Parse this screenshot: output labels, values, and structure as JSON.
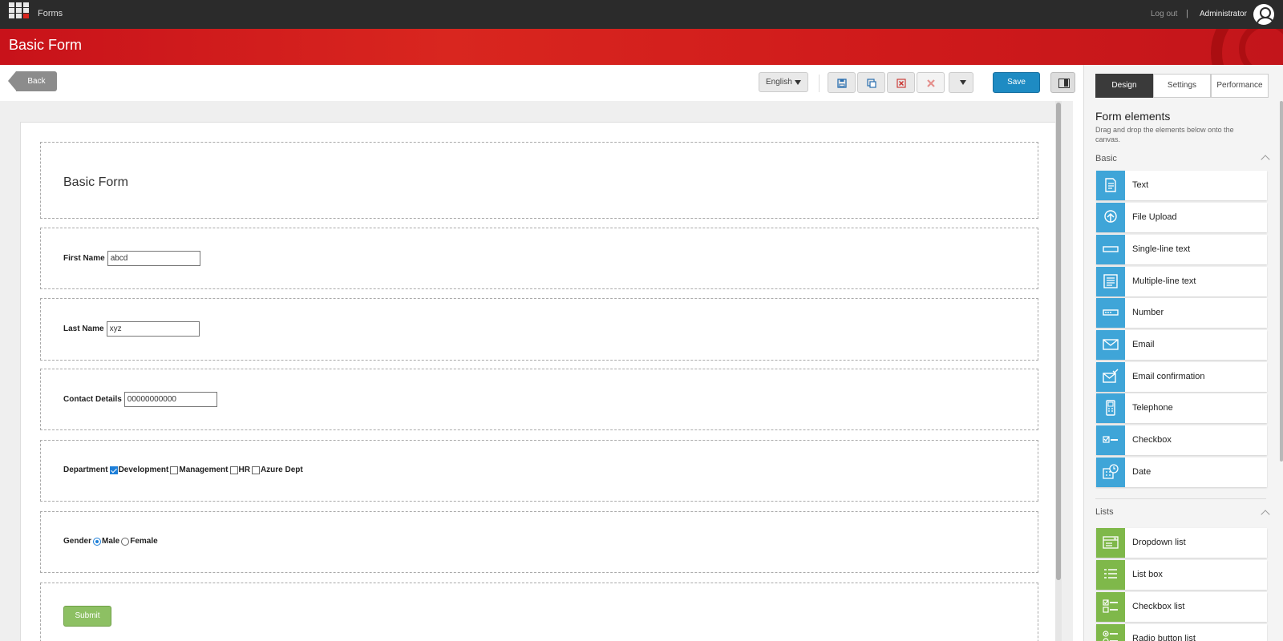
{
  "topbar": {
    "app_name": "Forms",
    "logout": "Log out",
    "separator": "|",
    "user": "Administrator"
  },
  "header": {
    "title": "Basic Form"
  },
  "toolbar": {
    "back": "Back",
    "language": "English",
    "save": "Save"
  },
  "form": {
    "title": "Basic Form",
    "first_name": {
      "label": "First Name",
      "value": "abcd"
    },
    "last_name": {
      "label": "Last Name",
      "value": "xyz"
    },
    "contact": {
      "label": "Contact Details",
      "value": "00000000000"
    },
    "department": {
      "label": "Department",
      "options": [
        {
          "label": "Development",
          "checked": true
        },
        {
          "label": "Management",
          "checked": false
        },
        {
          "label": "HR",
          "checked": false
        },
        {
          "label": "Azure Dept",
          "checked": false
        }
      ]
    },
    "gender": {
      "label": "Gender",
      "options": [
        {
          "label": "Male",
          "checked": true
        },
        {
          "label": "Female",
          "checked": false
        }
      ]
    },
    "submit": "Submit"
  },
  "panel": {
    "tabs": [
      "Design",
      "Settings",
      "Performance"
    ],
    "title": "Form elements",
    "description": "Drag and drop the elements below onto the canvas.",
    "basic_heading": "Basic",
    "basic_items": [
      {
        "label": "Text",
        "icon": "document-icon"
      },
      {
        "label": "File Upload",
        "icon": "upload-icon"
      },
      {
        "label": "Single-line text",
        "icon": "single-line-icon"
      },
      {
        "label": "Multiple-line text",
        "icon": "multi-line-icon"
      },
      {
        "label": "Number",
        "icon": "number-icon"
      },
      {
        "label": "Email",
        "icon": "envelope-icon"
      },
      {
        "label": "Email confirmation",
        "icon": "envelope-check-icon"
      },
      {
        "label": "Telephone",
        "icon": "phone-icon"
      },
      {
        "label": "Checkbox",
        "icon": "checkbox-icon"
      },
      {
        "label": "Date",
        "icon": "calendar-icon"
      }
    ],
    "lists_heading": "Lists",
    "list_items": [
      {
        "label": "Dropdown list",
        "icon": "dropdown-icon"
      },
      {
        "label": "List box",
        "icon": "listbox-icon"
      },
      {
        "label": "Checkbox list",
        "icon": "checkbox-list-icon"
      },
      {
        "label": "Radio button list",
        "icon": "radio-list-icon"
      }
    ]
  },
  "colors": {
    "accent_red": "#d9261f",
    "save_blue": "#1e8bc3",
    "submit_green": "#8dc063",
    "icon_blue": "#3fa5d8",
    "icon_green": "#7fb84a"
  }
}
